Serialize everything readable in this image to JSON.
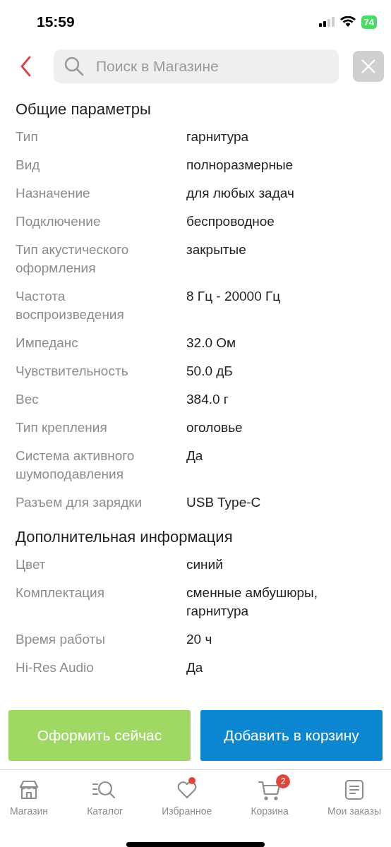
{
  "status_bar": {
    "time": "15:59",
    "battery": "74"
  },
  "header": {
    "search": {
      "placeholder": "Поиск в Магазине"
    }
  },
  "sections": [
    {
      "title": "Общие параметры",
      "rows": [
        {
          "label": "Тип",
          "value": "гарнитура"
        },
        {
          "label": "Вид",
          "value": "полноразмерные"
        },
        {
          "label": "Назначение",
          "value": "для любых задач"
        },
        {
          "label": "Подключение",
          "value": "беспроводное"
        },
        {
          "label": "Тип акустического оформления",
          "value": "закрытые"
        },
        {
          "label": "Частота воспроизведения",
          "value": "8 Гц - 20000 Гц"
        },
        {
          "label": "Импеданс",
          "value": "32.0 Ом"
        },
        {
          "label": "Чувствительность",
          "value": "50.0 дБ"
        },
        {
          "label": "Вес",
          "value": "384.0 г"
        },
        {
          "label": "Тип крепления",
          "value": "оголовье"
        },
        {
          "label": "Система активного шумоподавления",
          "value": "Да"
        },
        {
          "label": "Разъем для зарядки",
          "value": "USB Type-C"
        }
      ]
    },
    {
      "title": "Дополнительная информация",
      "rows": [
        {
          "label": "Цвет",
          "value": "синий"
        },
        {
          "label": "Комплектация",
          "value": "сменные амбушюры, гарнитура"
        },
        {
          "label": "Время работы",
          "value": "20 ч"
        },
        {
          "label": "Hi-Res Audio",
          "value": "Да"
        }
      ]
    }
  ],
  "actions": [
    {
      "label": "Оформить сейчас",
      "kind": "checkout"
    },
    {
      "label": "Добавить в корзину",
      "kind": "cart"
    }
  ],
  "tab_bar": [
    {
      "label": "Магазин",
      "kind": "shop"
    },
    {
      "label": "Каталог",
      "kind": "catalog"
    },
    {
      "label": "Избранное",
      "kind": "favorites",
      "dot": true
    },
    {
      "label": "Корзина",
      "kind": "cart",
      "badge": "2"
    },
    {
      "label": "Мои заказы",
      "kind": "orders"
    }
  ]
}
